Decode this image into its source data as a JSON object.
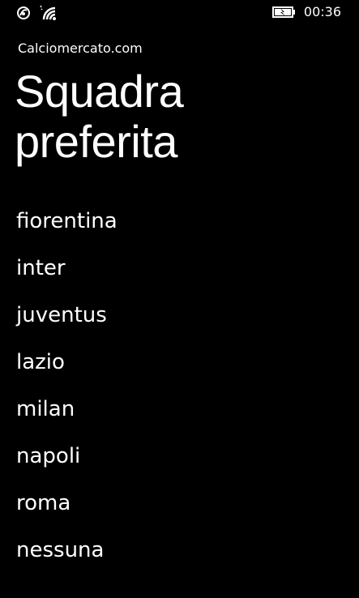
{
  "status_bar": {
    "time": "00:36",
    "icons": [
      "nfc-icon",
      "wifi-icon",
      "battery-charging-icon"
    ]
  },
  "app": {
    "name": "Calciomercato.com"
  },
  "page": {
    "title_line1": "Squadra",
    "title_line2": "preferita"
  },
  "teams": [
    {
      "label": "fiorentina"
    },
    {
      "label": "inter"
    },
    {
      "label": "juventus"
    },
    {
      "label": "lazio"
    },
    {
      "label": "milan"
    },
    {
      "label": "napoli"
    },
    {
      "label": "roma"
    },
    {
      "label": "nessuna"
    }
  ],
  "colors": {
    "background": "#000000",
    "foreground": "#ffffff"
  }
}
